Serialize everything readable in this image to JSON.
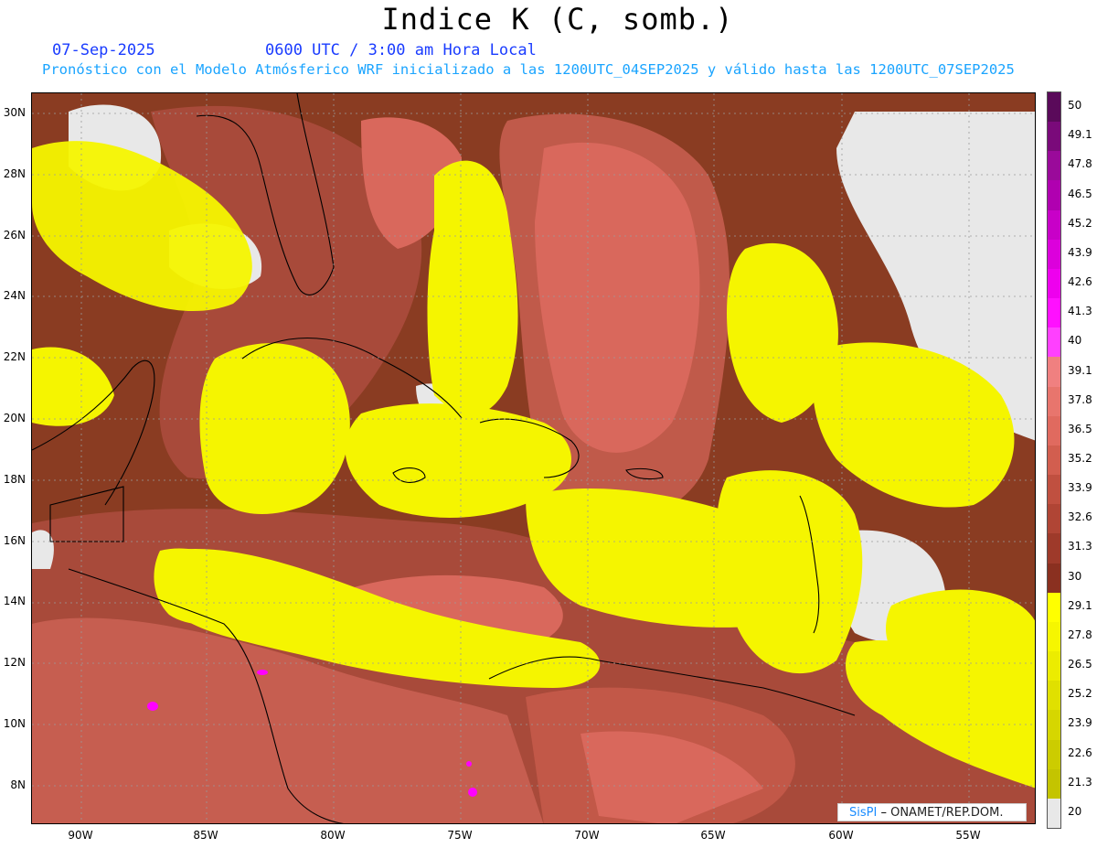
{
  "header": {
    "title": "Indice K (C, somb.)",
    "date": "07-Sep-2025",
    "time": "0600 UTC / 3:00 am Hora Local",
    "description": "Pronóstico con el Modelo Atmósferico WRF inicializado a las 1200UTC_04SEP2025 y válido hasta las  1200UTC_07SEP2025"
  },
  "axes": {
    "lat_labels": [
      "30N",
      "28N",
      "26N",
      "24N",
      "22N",
      "20N",
      "18N",
      "16N",
      "14N",
      "12N",
      "10N",
      "8N"
    ],
    "lon_labels": [
      "90W",
      "85W",
      "80W",
      "75W",
      "70W",
      "65W",
      "60W",
      "55W"
    ]
  },
  "colorbar": {
    "labels": [
      "50",
      "49.1",
      "47.8",
      "46.5",
      "45.2",
      "43.9",
      "42.6",
      "41.3",
      "40",
      "39.1",
      "37.8",
      "36.5",
      "35.2",
      "33.9",
      "32.6",
      "31.3",
      "30",
      "29.1",
      "27.8",
      "26.5",
      "25.2",
      "23.9",
      "22.6",
      "21.3",
      "20"
    ],
    "colors": [
      "#5a0a5a",
      "#7a0a7a",
      "#9a0a9a",
      "#b000b0",
      "#c800c8",
      "#dc00dc",
      "#ee00ee",
      "#ff10ff",
      "#ff40ff",
      "#f08080",
      "#e8756d",
      "#e06a5f",
      "#d25e4f",
      "#c05040",
      "#b04535",
      "#9e3a2a",
      "#8a3020",
      "#ffff00",
      "#f6f600",
      "#ecec00",
      "#e0e000",
      "#d6d600",
      "#cccc00",
      "#c4c400",
      "#e8e8e8"
    ]
  },
  "credit": {
    "logo": "SisPI",
    "org": "ONAMET/REP.DOM."
  },
  "palette": {
    "dark_brown": "#8a3c22",
    "mid_brown": "#a8473a",
    "salmon": "#d9685c",
    "pink": "#e7857a",
    "yellow": "#f5f500",
    "light_yellow": "#e6e610",
    "grey": "#e8e8e8",
    "magenta": "#ff00ff"
  }
}
